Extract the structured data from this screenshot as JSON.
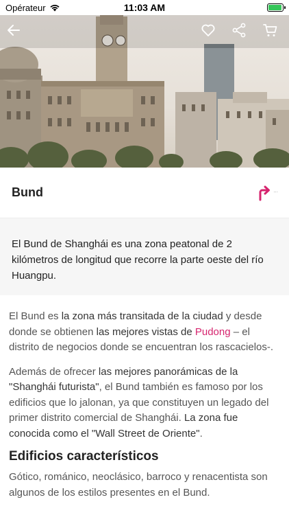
{
  "status_bar": {
    "carrier": "Opérateur",
    "time": "11:03 AM",
    "battery_level": 0.95,
    "battery_color": "#35c659"
  },
  "header_icons": [
    "back-arrow-icon",
    "heart-icon",
    "share-icon",
    "cart-icon"
  ],
  "place": {
    "title": "Bund",
    "direction_icon_color": "#d6246e",
    "direction_dots": "..."
  },
  "intro": "El Bund de Shanghái es una zona peatonal de 2 kilómetros de longitud que recorre la parte oeste del río Huangpu.",
  "paragraph1": {
    "t1": "El Bund es ",
    "b1": "la zona más transitada de la ciudad",
    "t2": " y desde donde se obtienen ",
    "b2": "las mejores vistas de",
    "link": "Pudong",
    "t3": " – el distrito de negocios donde se encuentran los rascacielos-."
  },
  "paragraph2": {
    "t1": "Además de ofrecer ",
    "b1": "las mejores panorámicas de la \"Shanghái futurista\"",
    "t2": ", el Bund también es famoso por los edificios que lo jalonan, ya que constituyen un legado del primer distrito comercial de Shanghái. ",
    "b2": "La zona fue conocida como el \"Wall Street de Oriente\"",
    "t3": "."
  },
  "section_heading": "Edificios característicos",
  "paragraph3": "Gótico, románico, neoclásico, barroco y renacentista son algunos de los estilos presentes en el Bund.",
  "accent_color": "#d6246e"
}
